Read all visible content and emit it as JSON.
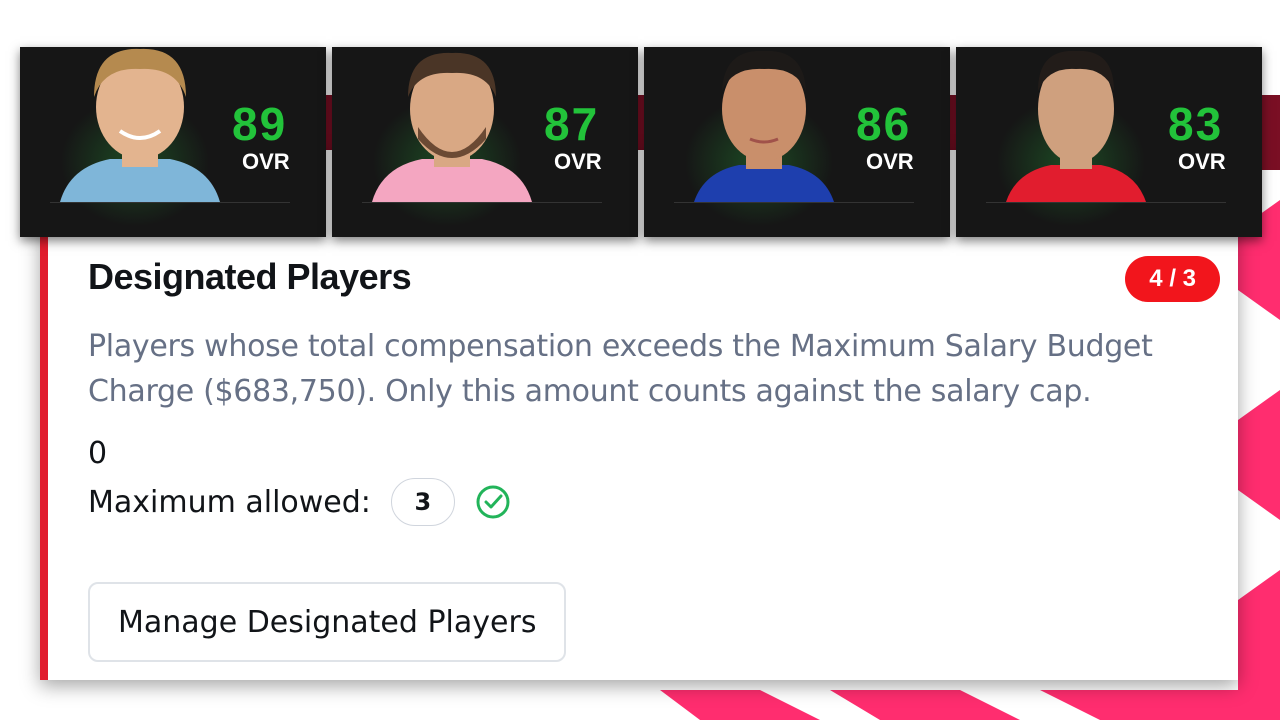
{
  "players": [
    {
      "rating": "89",
      "ovr_label": "OVR",
      "hair": "#b58a4f",
      "skin": "#e3b48f",
      "shirt": "#7fb6d9"
    },
    {
      "rating": "87",
      "ovr_label": "OVR",
      "hair": "#4a3526",
      "skin": "#d9a884",
      "shirt": "#f4a6c1"
    },
    {
      "rating": "86",
      "ovr_label": "OVR",
      "hair": "#1d1a18",
      "skin": "#c98f6b",
      "shirt": "#1e3fae"
    },
    {
      "rating": "83",
      "ovr_label": "OVR",
      "hair": "#221c19",
      "skin": "#cfa07e",
      "shirt": "#e11d2e"
    }
  ],
  "section": {
    "title": "Designated Players",
    "badge": "4 / 3",
    "description": "Players whose total compensation exceeds the Maximum Salary Budget Charge ($683,750). Only this amount counts against the salary cap.",
    "count": "0",
    "max_label": "Maximum allowed:",
    "max_value": "3",
    "manage_button": "Manage Designated Players"
  },
  "colors": {
    "accent_red": "#e11d2e",
    "badge_red": "#f2151c",
    "rating_green": "#22c33a",
    "check_green": "#22b45a",
    "stripe_pink": "#ff2d6f"
  }
}
